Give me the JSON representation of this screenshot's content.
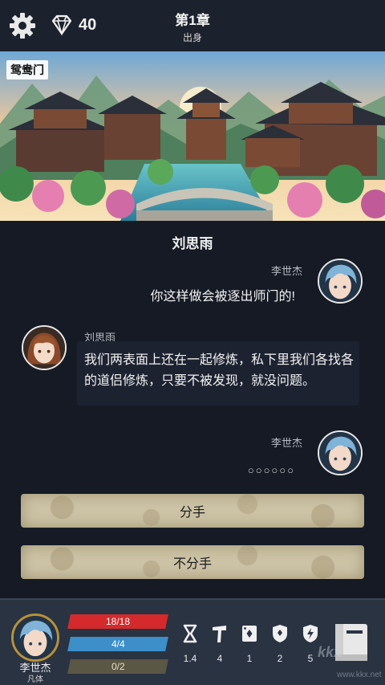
{
  "header": {
    "gems": "40",
    "chapter": "第1章",
    "chapter_subtitle": "出身"
  },
  "scene": {
    "location": "鸳鸯门"
  },
  "dialog": {
    "current_speaker": "刘思雨",
    "lines": [
      {
        "speaker": "李世杰",
        "side": "right",
        "text": "你这样做会被逐出师门的!"
      },
      {
        "speaker": "刘思雨",
        "side": "left",
        "text": "我们两表面上还在一起修炼，私下里我们各找各的道侣修炼，只要不被发现，就没问题。"
      },
      {
        "speaker": "李世杰",
        "side": "right",
        "text": "○○○○○○"
      }
    ]
  },
  "choices": [
    "分手",
    "不分手"
  ],
  "player": {
    "name": "李世杰",
    "realm": "凡体",
    "hp": "18/18",
    "mp": "4/4",
    "xp": "0/2",
    "attributes": [
      {
        "icon": "hourglass-icon",
        "value": "1.4"
      },
      {
        "icon": "hammer-icon",
        "value": "4"
      },
      {
        "icon": "card-icon",
        "value": "1"
      },
      {
        "icon": "shield-icon",
        "value": "2"
      },
      {
        "icon": "lightning-icon",
        "value": "5"
      }
    ]
  },
  "watermark": {
    "main": "kkx",
    "sub": "www.kkx.net"
  },
  "colors": {
    "background": "#151a25",
    "hp_bar": "#d42a2c",
    "mp_bar": "#3c8fc9",
    "xp_bar": "#5b5745",
    "choice_button": "#cdc3a6",
    "avatar_frame": "#b8913a"
  }
}
